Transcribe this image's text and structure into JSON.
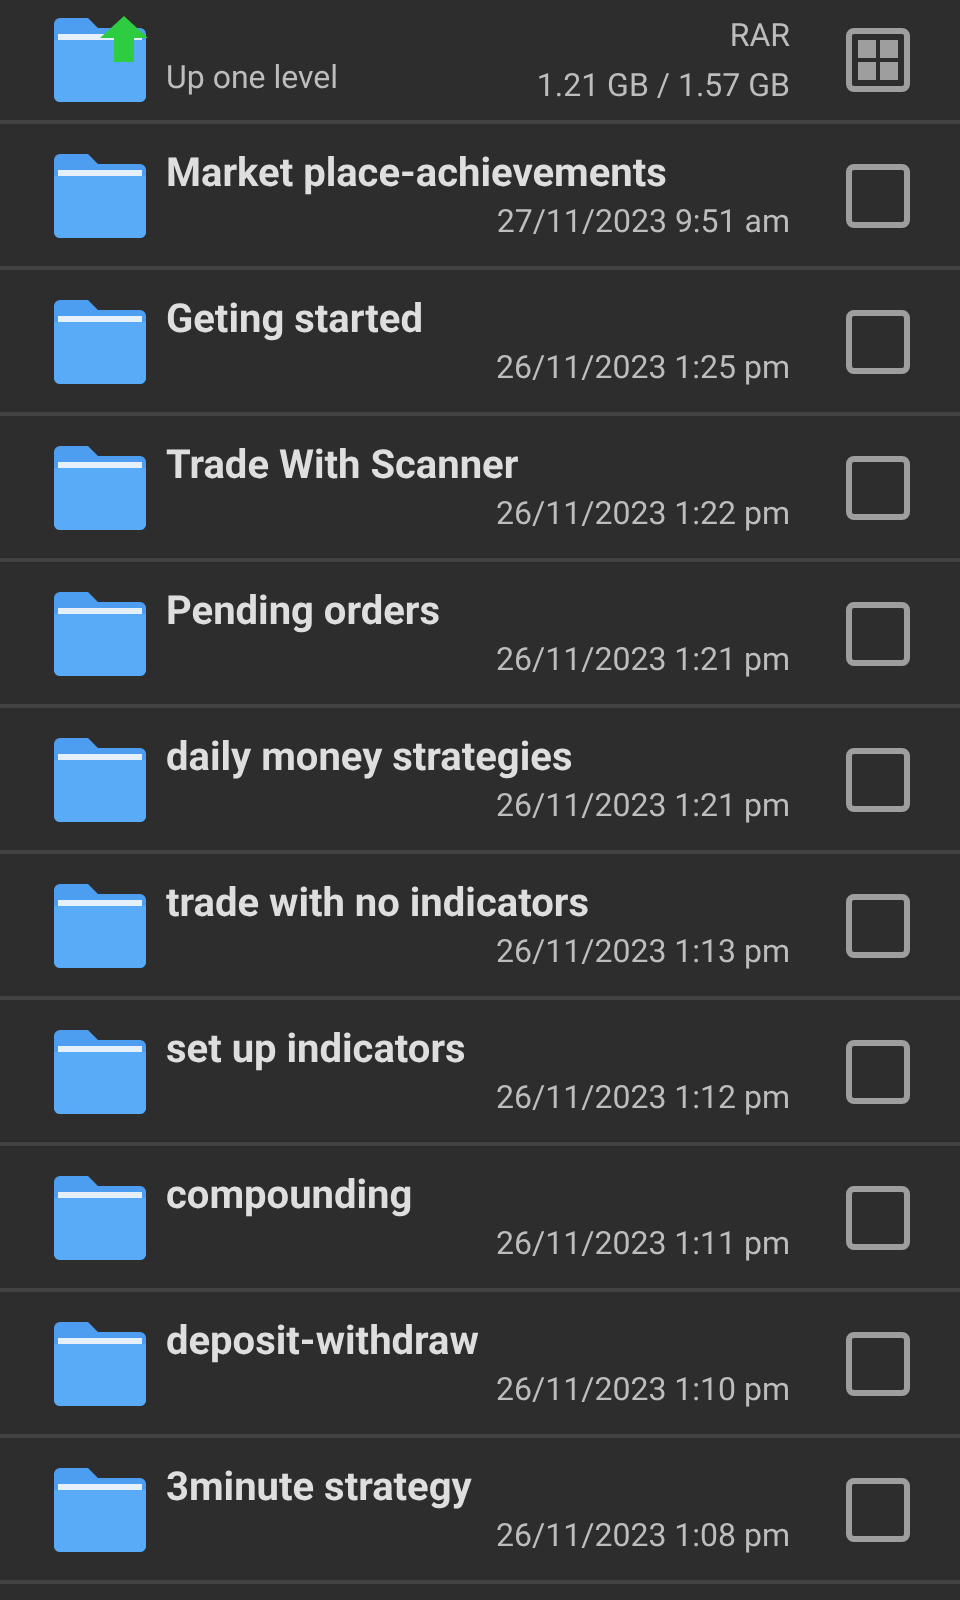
{
  "header": {
    "up_label": "Up one level",
    "archive_type": "RAR",
    "size": "1.21 GB / 1.57 GB"
  },
  "items": [
    {
      "name": "Market place-achievements",
      "date": "27/11/2023 9:51 am",
      "checked": false
    },
    {
      "name": "Geting started",
      "date": "26/11/2023 1:25 pm",
      "checked": false
    },
    {
      "name": "Trade With Scanner",
      "date": "26/11/2023 1:22 pm",
      "checked": false
    },
    {
      "name": "Pending orders",
      "date": "26/11/2023 1:21 pm",
      "checked": false
    },
    {
      "name": "daily money strategies",
      "date": "26/11/2023 1:21 pm",
      "checked": false
    },
    {
      "name": "trade with no indicators",
      "date": "26/11/2023 1:13 pm",
      "checked": false
    },
    {
      "name": "set up indicators",
      "date": "26/11/2023 1:12 pm",
      "checked": false
    },
    {
      "name": "compounding",
      "date": "26/11/2023 1:11 pm",
      "checked": false
    },
    {
      "name": "deposit-withdraw",
      "date": "26/11/2023 1:10 pm",
      "checked": false
    },
    {
      "name": "3minute strategy",
      "date": "26/11/2023 1:08 pm",
      "checked": false
    }
  ]
}
